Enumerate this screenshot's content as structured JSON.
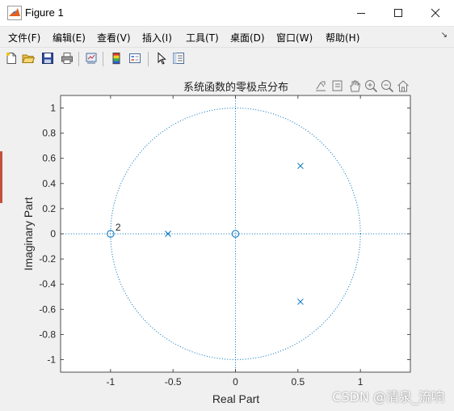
{
  "window": {
    "title": "Figure 1"
  },
  "menu": [
    {
      "id": "file",
      "label": "文件(F)"
    },
    {
      "id": "edit",
      "label": "编辑(E)"
    },
    {
      "id": "view",
      "label": "查看(V)"
    },
    {
      "id": "insert",
      "label": "插入(I)"
    },
    {
      "id": "tools",
      "label": "工具(T)"
    },
    {
      "id": "desktop",
      "label": "桌面(D)"
    },
    {
      "id": "window",
      "label": "窗口(W)"
    },
    {
      "id": "help",
      "label": "帮助(H)"
    }
  ],
  "toolbar": {
    "icons": [
      "new-figure-icon",
      "open-file-icon",
      "save-icon",
      "print-icon",
      "link-plot-icon",
      "insert-colorbar-icon",
      "insert-legend-icon",
      "edit-plot-pointer-icon",
      "property-inspector-icon"
    ]
  },
  "axes_toolbar": {
    "icons": [
      "export-icon",
      "data-tips-icon",
      "pan-icon",
      "zoom-in-icon",
      "zoom-out-icon",
      "home-icon"
    ]
  },
  "colors": {
    "series": "#0072bd",
    "axes": "#262626",
    "background": "#f0f0f0"
  },
  "chart_data": {
    "type": "scatter",
    "title": "系统函数的零极点分布",
    "xlabel": "Real Part",
    "ylabel": "Imaginary Part",
    "xlim": [
      -1.4,
      1.4
    ],
    "ylim": [
      -1.1,
      1.1
    ],
    "xticks": [
      -1,
      -0.5,
      0,
      0.5,
      1
    ],
    "xtick_labels": [
      "-1",
      "-0.5",
      "0",
      "0.5",
      "1"
    ],
    "yticks": [
      1,
      0.8,
      0.6,
      0.4,
      0.2,
      0,
      -0.2,
      -0.4,
      -0.6,
      -0.8,
      -1
    ],
    "ytick_labels": [
      "1",
      "0.8",
      "0.6",
      "0.4",
      "0.2",
      "0",
      "-0.2",
      "-0.4",
      "-0.6",
      "-0.8",
      "-1"
    ],
    "grid": false,
    "unit_circle": true,
    "series": [
      {
        "marker": "o",
        "points": [
          [
            -1,
            0
          ],
          [
            0,
            0
          ]
        ]
      },
      {
        "marker": "x",
        "points": [
          [
            -0.54,
            0
          ],
          [
            0.52,
            0.54
          ],
          [
            0.52,
            -0.54
          ]
        ]
      }
    ],
    "annotations": [
      {
        "text": "2",
        "x": -1,
        "y": 0
      }
    ]
  },
  "watermark": "CSDN @清泉_流响"
}
